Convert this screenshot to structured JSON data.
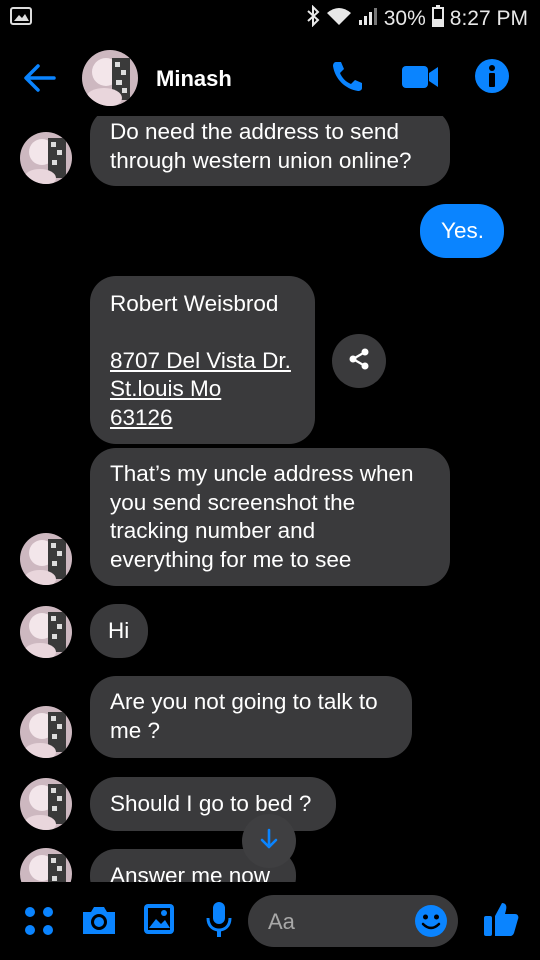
{
  "status_bar": {
    "battery": "30%",
    "time": "8:27 PM"
  },
  "header": {
    "contact_name": "Minash"
  },
  "messages": [
    {
      "from": "them",
      "lines": [
        "Do need the address to send",
        "through western union online?"
      ]
    },
    {
      "from": "me",
      "text": "Yes."
    },
    {
      "from": "them",
      "name": "Robert Weisbrod",
      "address_lines": [
        "8707 Del Vista Dr.",
        "St.louis Mo",
        "63126"
      ]
    },
    {
      "from": "them",
      "lines": [
        "That’s my uncle address when",
        "you send screenshot the",
        "tracking number and",
        "everything for me to see"
      ]
    },
    {
      "from": "them",
      "text": "Hi"
    },
    {
      "from": "them",
      "lines": [
        "Are you not going to talk to",
        "me ?"
      ]
    },
    {
      "from": "them",
      "text": "Should I go to bed ?"
    },
    {
      "from": "them",
      "text": "Answer me now"
    }
  ],
  "composer": {
    "placeholder": "Aa"
  },
  "colors": {
    "accent": "#0a84ff",
    "bubble_them": "#3a3a3c",
    "background": "#000000"
  }
}
